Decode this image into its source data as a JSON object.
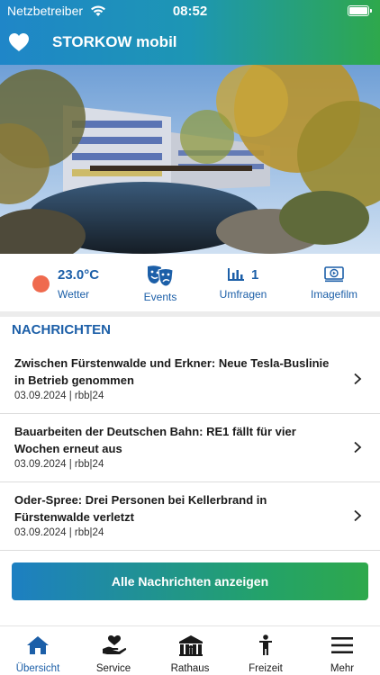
{
  "status_bar": {
    "carrier": "Netzbetreiber",
    "time": "08:52"
  },
  "app": {
    "title": "STORKOW mobil"
  },
  "quick": {
    "weather": {
      "temp": "23.0°C",
      "label": "Wetter"
    },
    "events": {
      "label": "Events"
    },
    "umfragen": {
      "count": "1",
      "label": "Umfragen"
    },
    "imagefilm": {
      "label": "Imagefilm"
    }
  },
  "news": {
    "header": "NACHRICHTEN",
    "items": [
      {
        "title": "Zwischen Fürstenwalde und Erkner: Neue Tesla-Buslinie in Betrieb genommen",
        "meta": "03.09.2024  |  rbb|24"
      },
      {
        "title": "Bauarbeiten der Deutschen Bahn: RE1 fällt für vier Wochen erneut aus",
        "meta": "03.09.2024  |  rbb|24"
      },
      {
        "title": "Oder-Spree: Drei Personen bei Kellerbrand in Fürstenwalde verletzt",
        "meta": "03.09.2024  |  rbb|24"
      }
    ],
    "all_button": "Alle Nachrichten anzeigen"
  },
  "tabs": [
    {
      "label": "Übersicht",
      "icon": "home-icon",
      "active": true
    },
    {
      "label": "Service",
      "icon": "hand-heart-icon",
      "active": false
    },
    {
      "label": "Rathaus",
      "icon": "townhall-icon",
      "active": false
    },
    {
      "label": "Freizeit",
      "icon": "person-icon",
      "active": false
    },
    {
      "label": "Mehr",
      "icon": "menu-icon",
      "active": false
    }
  ],
  "colors": {
    "brand_blue": "#1c5fa8",
    "gradient_start": "#1f86c8",
    "gradient_end": "#2ea84c",
    "weather_sun": "#ef6a4e"
  }
}
